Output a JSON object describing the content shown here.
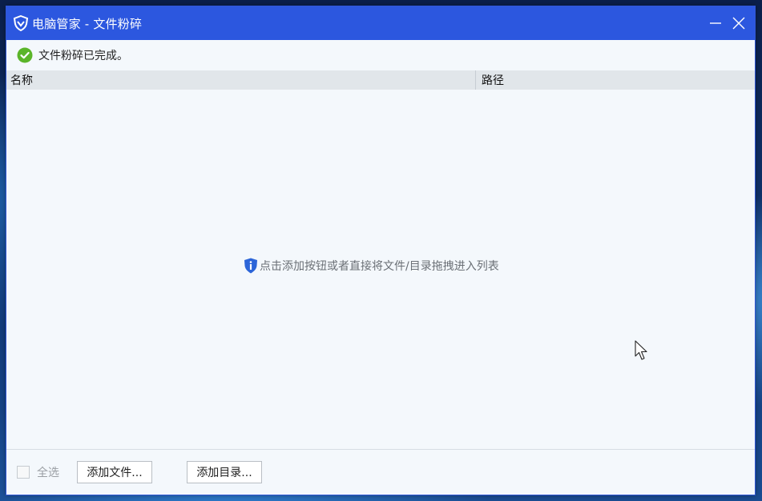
{
  "window": {
    "title": "电脑管家 - 文件粉碎"
  },
  "status": {
    "text": "文件粉碎已完成。",
    "icon": "check-circle-icon",
    "color": "#5bb52a"
  },
  "list": {
    "columns": [
      "名称",
      "路径"
    ],
    "empty_hint": "点击添加按钮或者直接将文件/目录拖拽进入列表",
    "hint_icon": "info-shield-icon"
  },
  "footer": {
    "select_all_label": "全选",
    "select_all_checked": false,
    "add_file_label": "添加文件...",
    "add_dir_label": "添加目录..."
  },
  "colors": {
    "titlebar": "#2c57df",
    "accent": "#2c57df",
    "background": "#f4f8fc"
  }
}
